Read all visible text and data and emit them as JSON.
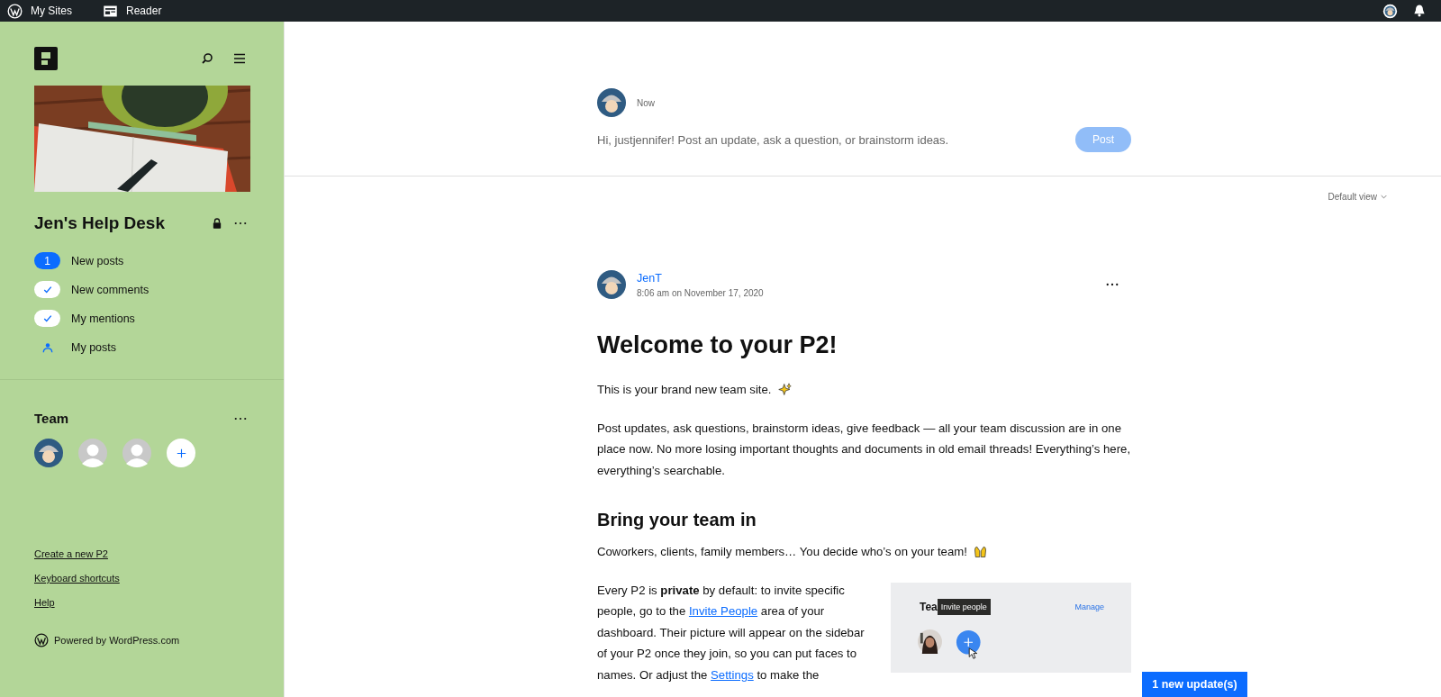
{
  "top_bar": {
    "items": [
      {
        "label": "My Sites",
        "kind": "wordpress"
      },
      {
        "label": "Reader",
        "kind": "reader"
      }
    ]
  },
  "sidebar": {
    "site_title": "Jen's Help Desk",
    "private": true,
    "filters": [
      {
        "label": "New posts",
        "kind": "count",
        "count": "1"
      },
      {
        "label": "New comments",
        "kind": "check",
        "checked": true
      },
      {
        "label": "My mentions",
        "kind": "check",
        "checked": true
      },
      {
        "label": "My posts",
        "kind": "person"
      }
    ],
    "team": {
      "title": "Team",
      "members": [
        {
          "kind": "avatar"
        },
        {
          "kind": "placeholder"
        },
        {
          "kind": "placeholder"
        }
      ]
    },
    "links": [
      "Create a new P2",
      "Keyboard shortcuts",
      "Help"
    ],
    "powered_by": "Powered by WordPress.com"
  },
  "composer": {
    "time": "Now",
    "placeholder": "Hi, justjennifer! Post an update, ask a question, or brainstorm ideas.",
    "button": "Post",
    "button_disabled": true
  },
  "view_menu": "Default view",
  "post": {
    "author": "JenT",
    "date": "8:06 am on November 17, 2020",
    "title": "Welcome to your P2!",
    "blocks": [
      {
        "kind": "paragraph",
        "segments": [
          {
            "text": "This is your brand new team site."
          }
        ],
        "emoji": {
          "kind": "sparkles"
        }
      },
      {
        "kind": "paragraph",
        "segments": [
          {
            "text": "Post updates, ask questions, brainstorm ideas, give feedback — all your team discussion are in one place now. No more losing important thoughts and documents in old email threads! Everything’s here, everything’s searchable."
          }
        ]
      },
      {
        "kind": "heading",
        "text": "Bring your team in"
      },
      {
        "kind": "paragraph",
        "segments": [
          {
            "text": "Coworkers, clients, family members… You decide who’s on your team!"
          }
        ],
        "emoji": {
          "kind": "raised-hands"
        }
      },
      {
        "kind": "paragraph",
        "figure": {
          "title": "Tea",
          "tooltip": "Invite people",
          "action": "Manage"
        },
        "segments": [
          {
            "text": "Every P2 is **private** by default: to invite specific people, go to the "
          },
          {
            "link": "Invite People"
          },
          {
            "text": " area of your dashboard. Their picture will appear on the sidebar of your P2 once they join, so you can put faces to names. Or adjust the "
          },
          {
            "link": "Settings"
          },
          {
            "text": " to make the"
          }
        ]
      }
    ]
  },
  "update_notice": "1 new update(s)"
}
